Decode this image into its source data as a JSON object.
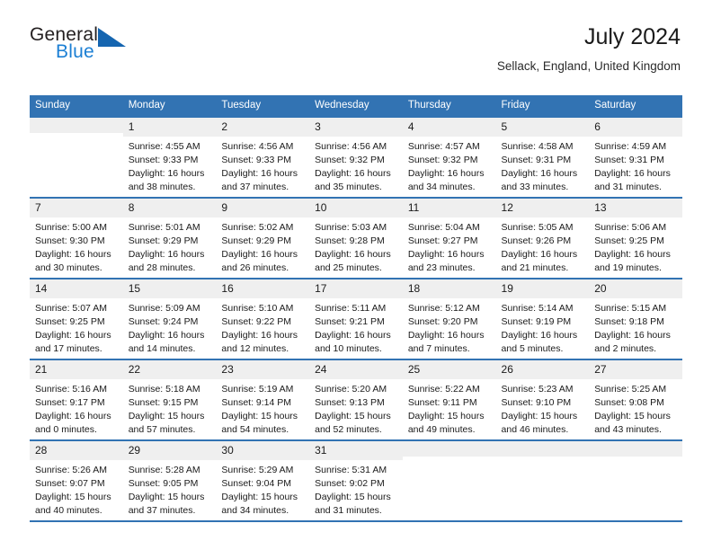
{
  "brand": {
    "name_part1": "General",
    "name_part2": "Blue",
    "logo_icon": "triangle-logo-icon",
    "accent_color": "#1565b0",
    "text_color": "#1b7fd4"
  },
  "header": {
    "title": "July 2024",
    "subtitle": "Sellack, England, United Kingdom",
    "header_background": "#3273b3",
    "daynum_background": "#efefef"
  },
  "weekday_headers": [
    "Sunday",
    "Monday",
    "Tuesday",
    "Wednesday",
    "Thursday",
    "Friday",
    "Saturday"
  ],
  "weeks": [
    [
      {
        "day": "",
        "empty": true,
        "sunrise": "",
        "sunset": "",
        "daylight_line1": "",
        "daylight_line2": ""
      },
      {
        "day": "1",
        "empty": false,
        "sunrise": "Sunrise: 4:55 AM",
        "sunset": "Sunset: 9:33 PM",
        "daylight_line1": "Daylight: 16 hours",
        "daylight_line2": "and 38 minutes."
      },
      {
        "day": "2",
        "empty": false,
        "sunrise": "Sunrise: 4:56 AM",
        "sunset": "Sunset: 9:33 PM",
        "daylight_line1": "Daylight: 16 hours",
        "daylight_line2": "and 37 minutes."
      },
      {
        "day": "3",
        "empty": false,
        "sunrise": "Sunrise: 4:56 AM",
        "sunset": "Sunset: 9:32 PM",
        "daylight_line1": "Daylight: 16 hours",
        "daylight_line2": "and 35 minutes."
      },
      {
        "day": "4",
        "empty": false,
        "sunrise": "Sunrise: 4:57 AM",
        "sunset": "Sunset: 9:32 PM",
        "daylight_line1": "Daylight: 16 hours",
        "daylight_line2": "and 34 minutes."
      },
      {
        "day": "5",
        "empty": false,
        "sunrise": "Sunrise: 4:58 AM",
        "sunset": "Sunset: 9:31 PM",
        "daylight_line1": "Daylight: 16 hours",
        "daylight_line2": "and 33 minutes."
      },
      {
        "day": "6",
        "empty": false,
        "sunrise": "Sunrise: 4:59 AM",
        "sunset": "Sunset: 9:31 PM",
        "daylight_line1": "Daylight: 16 hours",
        "daylight_line2": "and 31 minutes."
      }
    ],
    [
      {
        "day": "7",
        "empty": false,
        "sunrise": "Sunrise: 5:00 AM",
        "sunset": "Sunset: 9:30 PM",
        "daylight_line1": "Daylight: 16 hours",
        "daylight_line2": "and 30 minutes."
      },
      {
        "day": "8",
        "empty": false,
        "sunrise": "Sunrise: 5:01 AM",
        "sunset": "Sunset: 9:29 PM",
        "daylight_line1": "Daylight: 16 hours",
        "daylight_line2": "and 28 minutes."
      },
      {
        "day": "9",
        "empty": false,
        "sunrise": "Sunrise: 5:02 AM",
        "sunset": "Sunset: 9:29 PM",
        "daylight_line1": "Daylight: 16 hours",
        "daylight_line2": "and 26 minutes."
      },
      {
        "day": "10",
        "empty": false,
        "sunrise": "Sunrise: 5:03 AM",
        "sunset": "Sunset: 9:28 PM",
        "daylight_line1": "Daylight: 16 hours",
        "daylight_line2": "and 25 minutes."
      },
      {
        "day": "11",
        "empty": false,
        "sunrise": "Sunrise: 5:04 AM",
        "sunset": "Sunset: 9:27 PM",
        "daylight_line1": "Daylight: 16 hours",
        "daylight_line2": "and 23 minutes."
      },
      {
        "day": "12",
        "empty": false,
        "sunrise": "Sunrise: 5:05 AM",
        "sunset": "Sunset: 9:26 PM",
        "daylight_line1": "Daylight: 16 hours",
        "daylight_line2": "and 21 minutes."
      },
      {
        "day": "13",
        "empty": false,
        "sunrise": "Sunrise: 5:06 AM",
        "sunset": "Sunset: 9:25 PM",
        "daylight_line1": "Daylight: 16 hours",
        "daylight_line2": "and 19 minutes."
      }
    ],
    [
      {
        "day": "14",
        "empty": false,
        "sunrise": "Sunrise: 5:07 AM",
        "sunset": "Sunset: 9:25 PM",
        "daylight_line1": "Daylight: 16 hours",
        "daylight_line2": "and 17 minutes."
      },
      {
        "day": "15",
        "empty": false,
        "sunrise": "Sunrise: 5:09 AM",
        "sunset": "Sunset: 9:24 PM",
        "daylight_line1": "Daylight: 16 hours",
        "daylight_line2": "and 14 minutes."
      },
      {
        "day": "16",
        "empty": false,
        "sunrise": "Sunrise: 5:10 AM",
        "sunset": "Sunset: 9:22 PM",
        "daylight_line1": "Daylight: 16 hours",
        "daylight_line2": "and 12 minutes."
      },
      {
        "day": "17",
        "empty": false,
        "sunrise": "Sunrise: 5:11 AM",
        "sunset": "Sunset: 9:21 PM",
        "daylight_line1": "Daylight: 16 hours",
        "daylight_line2": "and 10 minutes."
      },
      {
        "day": "18",
        "empty": false,
        "sunrise": "Sunrise: 5:12 AM",
        "sunset": "Sunset: 9:20 PM",
        "daylight_line1": "Daylight: 16 hours",
        "daylight_line2": "and 7 minutes."
      },
      {
        "day": "19",
        "empty": false,
        "sunrise": "Sunrise: 5:14 AM",
        "sunset": "Sunset: 9:19 PM",
        "daylight_line1": "Daylight: 16 hours",
        "daylight_line2": "and 5 minutes."
      },
      {
        "day": "20",
        "empty": false,
        "sunrise": "Sunrise: 5:15 AM",
        "sunset": "Sunset: 9:18 PM",
        "daylight_line1": "Daylight: 16 hours",
        "daylight_line2": "and 2 minutes."
      }
    ],
    [
      {
        "day": "21",
        "empty": false,
        "sunrise": "Sunrise: 5:16 AM",
        "sunset": "Sunset: 9:17 PM",
        "daylight_line1": "Daylight: 16 hours",
        "daylight_line2": "and 0 minutes."
      },
      {
        "day": "22",
        "empty": false,
        "sunrise": "Sunrise: 5:18 AM",
        "sunset": "Sunset: 9:15 PM",
        "daylight_line1": "Daylight: 15 hours",
        "daylight_line2": "and 57 minutes."
      },
      {
        "day": "23",
        "empty": false,
        "sunrise": "Sunrise: 5:19 AM",
        "sunset": "Sunset: 9:14 PM",
        "daylight_line1": "Daylight: 15 hours",
        "daylight_line2": "and 54 minutes."
      },
      {
        "day": "24",
        "empty": false,
        "sunrise": "Sunrise: 5:20 AM",
        "sunset": "Sunset: 9:13 PM",
        "daylight_line1": "Daylight: 15 hours",
        "daylight_line2": "and 52 minutes."
      },
      {
        "day": "25",
        "empty": false,
        "sunrise": "Sunrise: 5:22 AM",
        "sunset": "Sunset: 9:11 PM",
        "daylight_line1": "Daylight: 15 hours",
        "daylight_line2": "and 49 minutes."
      },
      {
        "day": "26",
        "empty": false,
        "sunrise": "Sunrise: 5:23 AM",
        "sunset": "Sunset: 9:10 PM",
        "daylight_line1": "Daylight: 15 hours",
        "daylight_line2": "and 46 minutes."
      },
      {
        "day": "27",
        "empty": false,
        "sunrise": "Sunrise: 5:25 AM",
        "sunset": "Sunset: 9:08 PM",
        "daylight_line1": "Daylight: 15 hours",
        "daylight_line2": "and 43 minutes."
      }
    ],
    [
      {
        "day": "28",
        "empty": false,
        "sunrise": "Sunrise: 5:26 AM",
        "sunset": "Sunset: 9:07 PM",
        "daylight_line1": "Daylight: 15 hours",
        "daylight_line2": "and 40 minutes."
      },
      {
        "day": "29",
        "empty": false,
        "sunrise": "Sunrise: 5:28 AM",
        "sunset": "Sunset: 9:05 PM",
        "daylight_line1": "Daylight: 15 hours",
        "daylight_line2": "and 37 minutes."
      },
      {
        "day": "30",
        "empty": false,
        "sunrise": "Sunrise: 5:29 AM",
        "sunset": "Sunset: 9:04 PM",
        "daylight_line1": "Daylight: 15 hours",
        "daylight_line2": "and 34 minutes."
      },
      {
        "day": "31",
        "empty": false,
        "sunrise": "Sunrise: 5:31 AM",
        "sunset": "Sunset: 9:02 PM",
        "daylight_line1": "Daylight: 15 hours",
        "daylight_line2": "and 31 minutes."
      },
      {
        "day": "",
        "empty": true,
        "sunrise": "",
        "sunset": "",
        "daylight_line1": "",
        "daylight_line2": ""
      },
      {
        "day": "",
        "empty": true,
        "sunrise": "",
        "sunset": "",
        "daylight_line1": "",
        "daylight_line2": ""
      },
      {
        "day": "",
        "empty": true,
        "sunrise": "",
        "sunset": "",
        "daylight_line1": "",
        "daylight_line2": ""
      }
    ]
  ]
}
